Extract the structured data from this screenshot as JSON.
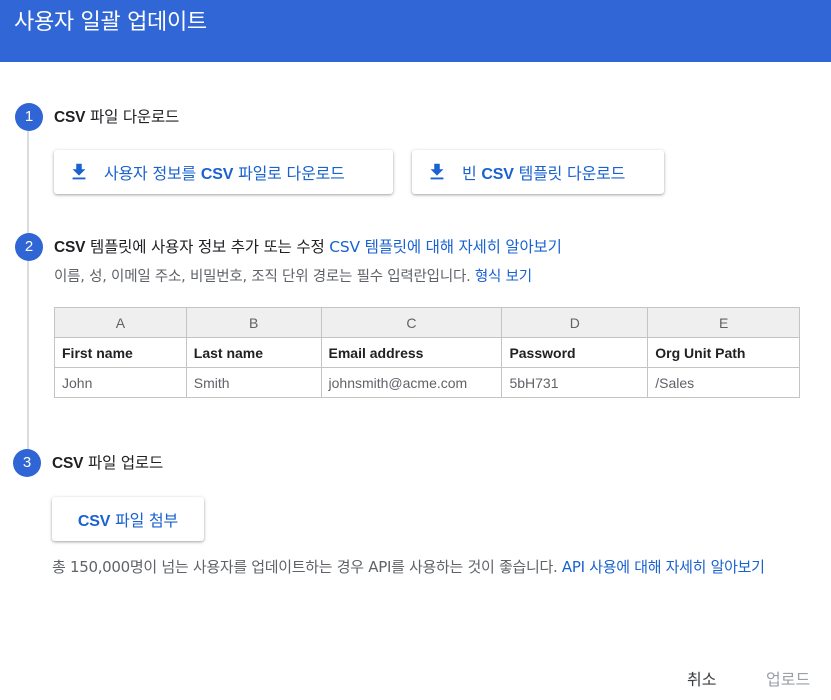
{
  "header": {
    "title": "사용자 일괄 업데이트",
    "color": "#3166d6"
  },
  "steps": [
    {
      "number": "1",
      "title_bold": "CSV",
      "title_rest": " 파일 다운로드"
    },
    {
      "number": "2",
      "title_bold": "CSV",
      "title_rest": " 템플릿에 사용자 정보 추가 또는 수정 ",
      "link": "CSV 템플릿에 대해 자세히 알아보기",
      "hint": "이름, 성, 이메일 주소, 비밀번호, 조직 단위 경로는 필수 입력란입니다. ",
      "hint_link": "형식 보기"
    },
    {
      "number": "3",
      "title_bold": "CSV",
      "title_rest": " 파일 업로드"
    }
  ],
  "download_buttons": [
    {
      "pre": "사용자 정보를 ",
      "bold": "CSV",
      "post": " 파일로 다운로드",
      "icon": "download-icon"
    },
    {
      "pre": "빈 ",
      "bold": "CSV",
      "post": " 템플릿 다운로드",
      "icon": "download-icon"
    }
  ],
  "template_table": {
    "column_letters": [
      "A",
      "B",
      "C",
      "D",
      "E"
    ],
    "headers": [
      "First name",
      "Last name",
      "Email address",
      "Password",
      "Org Unit Path"
    ],
    "row": [
      "John",
      "Smith",
      "johnsmith@acme.com",
      "5bH731",
      "/Sales"
    ]
  },
  "upload_button": {
    "bold": "CSV",
    "rest": " 파일 첨부"
  },
  "info": {
    "text": "총 150,000명이 넘는 사용자를 업데이트하는 경우 API를 사용하는 것이 좋습니다. ",
    "link": "API 사용에 대해 자세히 알아보기"
  },
  "footer": {
    "cancel": "취소",
    "upload": "업로드"
  },
  "colors": {
    "accent": "#2f65d4",
    "link": "#1a62d0",
    "disabled": "#9aa0a6"
  }
}
